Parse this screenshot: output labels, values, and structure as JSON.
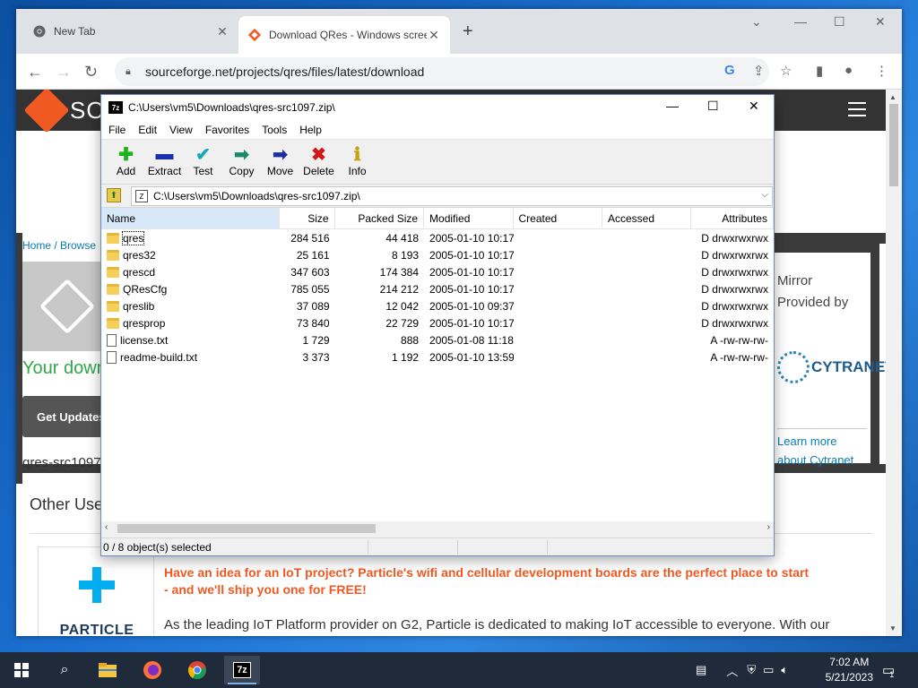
{
  "browser": {
    "tabs": [
      {
        "title": "New Tab",
        "close": "✕"
      },
      {
        "title": "Download QRes - Windows scree",
        "close": "✕"
      }
    ],
    "new_tab": "+",
    "address": "sourceforge.net/projects/qres/files/latest/download"
  },
  "site": {
    "logo_text": "SOURCEFORGE",
    "breadcrumb": "Home / Browse",
    "download_text": "Your download",
    "get_updates": "Get Updates",
    "filename": "qres-src1097",
    "mirror_line1": "Mirror",
    "mirror_line2": "Provided by",
    "cytranet": "CYTRANET",
    "learn_more_1": "Learn more",
    "learn_more_2": "about Cytranet",
    "other_useful": "Other Useful",
    "particle_label": "PARTICLE",
    "ad_headline": "Have an idea for an IoT project? Particle's wifi and cellular development boards are the perfect place to start - and we'll ship you one for FREE!",
    "ad_body": "As the leading IoT Platform provider on G2, Particle is dedicated to making IoT accessible to everyone. With our"
  },
  "zip": {
    "title": "C:\\Users\\vm5\\Downloads\\qres-src1097.zip\\",
    "app_icon": "7z",
    "menu": [
      "File",
      "Edit",
      "View",
      "Favorites",
      "Tools",
      "Help"
    ],
    "tools": [
      {
        "label": "Add",
        "glyph": "✚",
        "color": "#1db31d"
      },
      {
        "label": "Extract",
        "glyph": "▬",
        "color": "#1a2fb0"
      },
      {
        "label": "Test",
        "glyph": "✔",
        "color": "#18a8b8"
      },
      {
        "label": "Copy",
        "glyph": "➡",
        "color": "#1a8a6a"
      },
      {
        "label": "Move",
        "glyph": "➡",
        "color": "#1a2fa0"
      },
      {
        "label": "Delete",
        "glyph": "✖",
        "color": "#d01818"
      },
      {
        "label": "Info",
        "glyph": "ℹ",
        "color": "#c8a010"
      }
    ],
    "address": "C:\\Users\\vm5\\Downloads\\qres-src1097.zip\\",
    "columns": [
      "Name",
      "Size",
      "Packed Size",
      "Modified",
      "Created",
      "Accessed",
      "Attributes"
    ],
    "rows": [
      {
        "name": "qres",
        "type": "folder",
        "size": "284 516",
        "packed": "44 418",
        "modified": "2005-01-10 10:17",
        "attr": "D drwxrwxrwx"
      },
      {
        "name": "qres32",
        "type": "folder",
        "size": "25 161",
        "packed": "8 193",
        "modified": "2005-01-10 10:17",
        "attr": "D drwxrwxrwx"
      },
      {
        "name": "qrescd",
        "type": "folder",
        "size": "347 603",
        "packed": "174 384",
        "modified": "2005-01-10 10:17",
        "attr": "D drwxrwxrwx"
      },
      {
        "name": "QResCfg",
        "type": "folder",
        "size": "785 055",
        "packed": "214 212",
        "modified": "2005-01-10 10:17",
        "attr": "D drwxrwxrwx"
      },
      {
        "name": "qreslib",
        "type": "folder",
        "size": "37 089",
        "packed": "12 042",
        "modified": "2005-01-10 09:37",
        "attr": "D drwxrwxrwx"
      },
      {
        "name": "qresprop",
        "type": "folder",
        "size": "73 840",
        "packed": "22 729",
        "modified": "2005-01-10 10:17",
        "attr": "D drwxrwxrwx"
      },
      {
        "name": "license.txt",
        "type": "file",
        "size": "1 729",
        "packed": "888",
        "modified": "2005-01-08 11:18",
        "attr": "A -rw-rw-rw-"
      },
      {
        "name": "readme-build.txt",
        "type": "file",
        "size": "3 373",
        "packed": "1 192",
        "modified": "2005-01-10 13:59",
        "attr": "A -rw-rw-rw-"
      }
    ],
    "status": "0 / 8 object(s) selected"
  },
  "taskbar": {
    "time": "7:02 AM",
    "date": "5/21/2023",
    "notification_count": "1",
    "zip_label": "7z"
  }
}
